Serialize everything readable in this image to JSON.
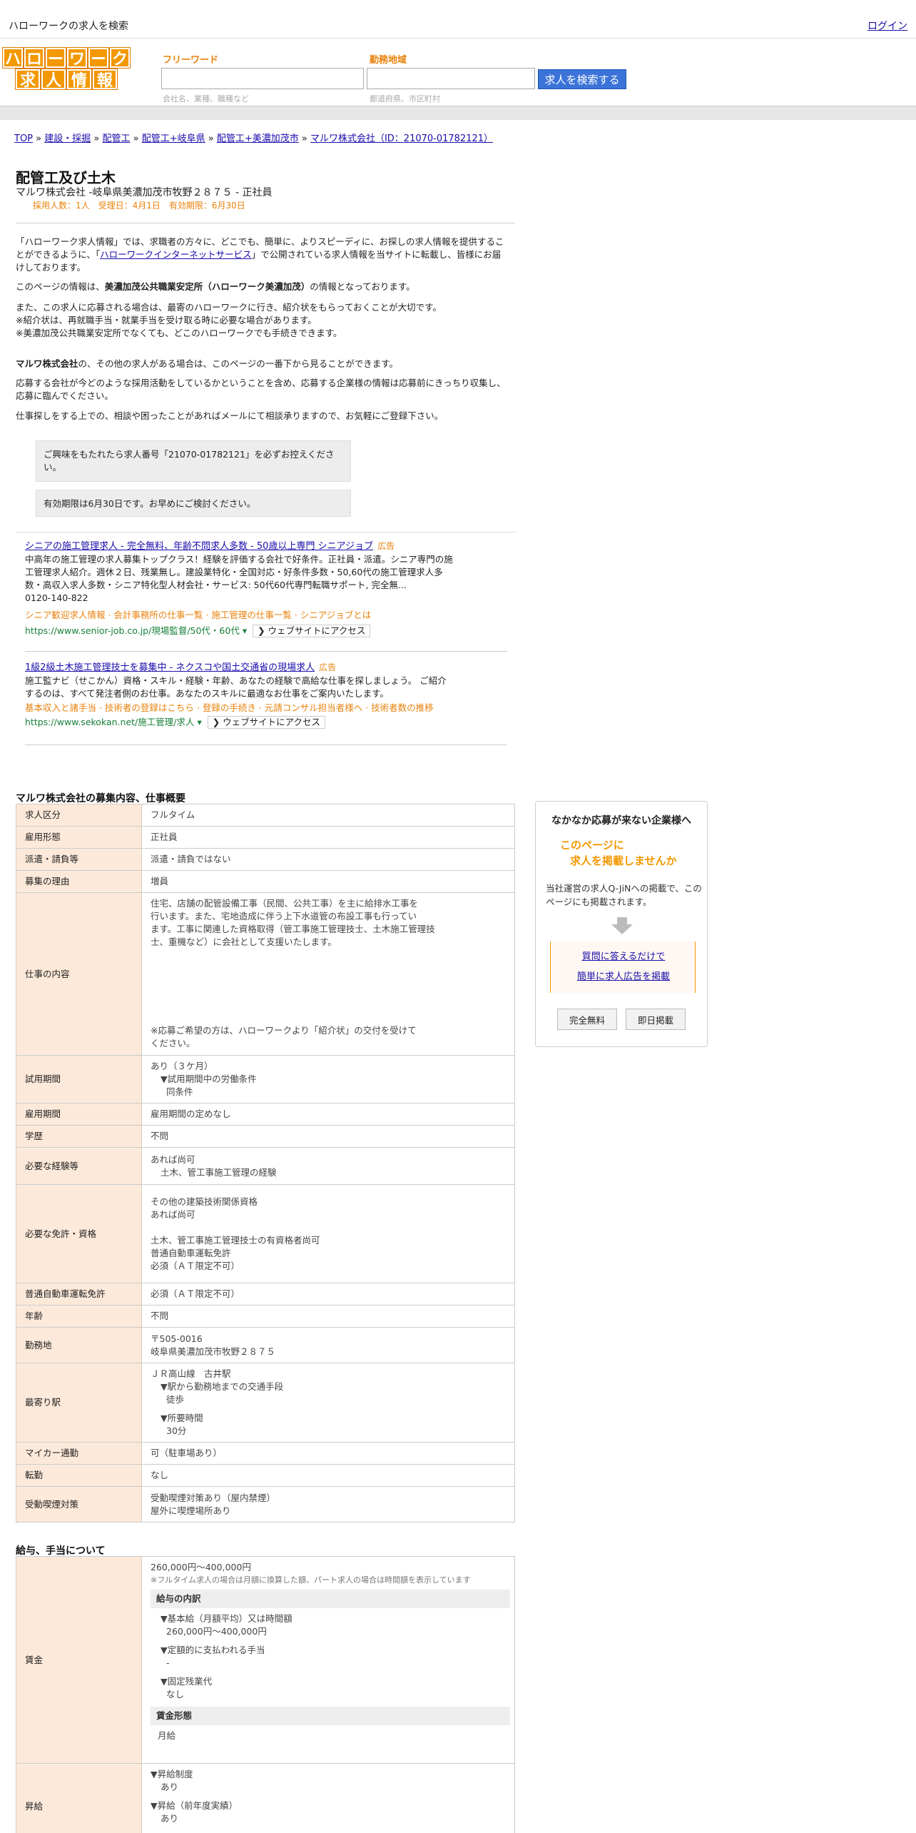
{
  "top": {
    "site_title": "ハローワークの求人を検索",
    "login": "ログイン"
  },
  "logo": {
    "row1": [
      "ハ",
      "ロ",
      "ー",
      "ワ",
      "ー",
      "ク"
    ],
    "row2": [
      "求",
      "人",
      "情",
      "報"
    ]
  },
  "search": {
    "freeword_label": "フリーワード",
    "freeword_hint": "会社名、業種、職種など",
    "area_label": "勤務地域",
    "area_hint": "都道府県、市区町村",
    "button": "求人を検索する"
  },
  "breadcrumb": {
    "items": [
      "TOP",
      "建設・採掘",
      "配管工",
      "配管工+岐阜県",
      "配管工+美濃加茂市",
      "マルワ株式会社（ID：21070-01782121）"
    ],
    "sep": " » "
  },
  "job": {
    "title": "配管工及び土木",
    "company": "マルワ株式会社 -岐阜県美濃加茂市牧野２８７５ - 正社員",
    "meta": "採用人数：1人　受理日：4月1日　有効期限：6月30日"
  },
  "intro": {
    "p1a": "「ハローワーク求人情報」では、求職者の方々に、どこでも、簡単に、よりスピーディに、お探しの求人情報を提供することができるように、「",
    "p1link": "ハローワークインターネットサービス",
    "p1b": "」で公開されている求人情報を当サイトに転載し、皆様にお届けしております。",
    "p2a": "このページの情報は、",
    "p2b": "美濃加茂公共職業安定所（ハローワーク美濃加茂）",
    "p2c": "の情報となっております。",
    "p3_1": "また、この求人に応募される場合は、最寄のハローワークに行き、紹介状をもらっておくことが大切です。",
    "p3_2": "※紹介状は、再就職手当・就業手当を受け取る時に必要な場合があります。",
    "p3_3": "※美濃加茂公共職業安定所でなくても、どこのハローワークでも手続きできます。",
    "p4a": "マルワ株式会社",
    "p4b": "の、その他の求人がある場合は、このページの一番下から見ることができます。",
    "p5": "応募する会社が今どのような採用活動をしているかということを含め、応募する企業様の情報は応募前にきっちり収集し、応募に臨んでください。",
    "p6": "仕事探しをする上での、相談や困ったことがあればメールにて相談承りますので、お気軽にご登録下さい。"
  },
  "notices": [
    "ご興味をもたれたら求人番号「21070-01782121」を必ずお控えください。",
    "有効期限は6月30日です。お早めにご検討ください。"
  ],
  "ads": [
    {
      "title": "シニアの施工管理求人 - 完全無料、年齢不問求人多数 - 50歳以上専門 シニアジョブ",
      "tag": "広告",
      "desc": "中高年の施工管理の求人募集トップクラス！経験を評価する会社で好条件。正社員・派遣。シニア専門の施工管理求人紹介。週休２日、残業無し。建設業特化・全国対応・好条件多数・50,60代の施工管理求人多数・高収入求人多数・シニア特化型人材会社・サービス: 50代60代専門転職サポート, 完全無...",
      "phone": "0120-140-822",
      "links": "シニア歓迎求人情報 · 会計事務所の仕事一覧 · 施工管理の仕事一覧 · シニアジョブとは",
      "url": "https://www.senior-job.co.jp/現場監督/50代・60代",
      "visit": "ウェブサイトにアクセス"
    },
    {
      "title": "1級2級土木施工管理技士を募集中 - ネクスコや国土交通省の現場求人",
      "tag": "広告",
      "desc": "施工監ナビ（せこかん）資格・スキル・経験・年齢、あなたの経験で高給な仕事を探しましょう。 ご紹介するのは、すべて発注者側のお仕事。あなたのスキルに最適なお仕事をご案内いたします。",
      "phone": "",
      "links": "基本収入と諸手当 · 技術者の登録はこちら · 登録の手続き · 元請コンサル担当者様へ · 技術者数の推移",
      "url": "https://www.sekokan.net/施工管理/求人",
      "visit": "ウェブサイトにアクセス"
    }
  ],
  "details": {
    "title": "マルワ株式会社の募集内容、仕事概要",
    "rows": {
      "kyujin_kubun": {
        "k": "求人区分",
        "v": "フルタイム"
      },
      "koyo_keitai": {
        "k": "雇用形態",
        "v": "正社員"
      },
      "haken": {
        "k": "派遣・請負等",
        "v": "派遣・請負ではない"
      },
      "riyu": {
        "k": "募集の理由",
        "v": "増員"
      },
      "shigoto": {
        "k": "仕事の内容",
        "v1": "住宅、店舗の配管設備工事（民間、公共工事）を主に給排水工事を",
        "v2": "行います。また、宅地造成に伴う上下水道管の布設工事も行ってい",
        "v3": "ます。工事に関連した資格取得（管工事施工管理技士、土木施工管理技",
        "v4": "士、重機など）に会社として支援いたします。",
        "v5": "※応募ご希望の方は、ハローワークより「紹介状」の交付を受けて",
        "v6": "ください。"
      },
      "shiyo": {
        "k": "試用期間",
        "v1": "あり（３ケ月）",
        "v2": "▼試用期間中の労働条件",
        "v3": "同条件"
      },
      "koyo_kikan": {
        "k": "雇用期間",
        "v": "雇用期間の定めなし"
      },
      "gakureki": {
        "k": "学歴",
        "v": "不問"
      },
      "keiken": {
        "k": "必要な経験等",
        "v1": "あれば尚可",
        "v2": "土木、管工事施工管理の経験"
      },
      "menkyo": {
        "k": "必要な免許・資格",
        "v1": "その他の建築技術関係資格",
        "v2": "あれば尚可",
        "v3": "土木、管工事施工管理技士の有資格者尚可",
        "v4": "普通自動車運転免許",
        "v5": "必須（ＡＴ限定不可）"
      },
      "futsu": {
        "k": "普通自動車運転免許",
        "v": "必須（ＡＴ限定不可）"
      },
      "nenrei": {
        "k": "年齢",
        "v": "不問"
      },
      "kinmuchi": {
        "k": "勤務地",
        "v1": "〒505-0016",
        "v2": "岐阜県美濃加茂市牧野２８７５"
      },
      "eki": {
        "k": "最寄り駅",
        "v1": "ＪＲ高山線　古井駅",
        "v2": "▼駅から勤務地までの交通手段",
        "v3": "徒歩",
        "v4": "▼所要時間",
        "v5": "30分"
      },
      "mycar": {
        "k": "マイカー通勤",
        "v": "可（駐車場あり）"
      },
      "tenkin": {
        "k": "転勤",
        "v": "なし"
      },
      "kitsuen": {
        "k": "受動喫煙対策",
        "v1": "受動喫煙対策あり（屋内禁煙）",
        "v2": "屋外に喫煙場所あり"
      }
    }
  },
  "salary": {
    "title": "給与、手当について",
    "chingin": {
      "k": "賃金",
      "range": "260,000円〜400,000円",
      "note": "※フルタイム求人の場合は月額に換算した額、パート求人の場合は時間額を表示しています",
      "sub1": "給与の内訳",
      "b1": "▼基本給（月額平均）又は時間額",
      "b1v": "260,000円〜400,000円",
      "b2": "▼定額的に支払われる手当",
      "b2v": "-",
      "b3": "▼固定残業代",
      "b3v": "なし",
      "sub2": "賃金形態",
      "form": "月給"
    },
    "shokyu": {
      "k": "昇給",
      "a1": "▼昇給制度",
      "a1v": "あり",
      "a2": "▼昇給（前年度実績）",
      "a2v": "あり"
    }
  },
  "side": {
    "title": "なかなか応募が来ない企業様へ",
    "hl1": "このページに",
    "hl2": "求人を掲載しませんか",
    "text": "当社運営の求人Q-JiNへの掲載で、このページにも掲載されます。",
    "link1": "質問に答えるだけで",
    "link2": "簡単に求人広告を掲載",
    "btn1": "完全無料",
    "btn2": "即日掲載"
  }
}
